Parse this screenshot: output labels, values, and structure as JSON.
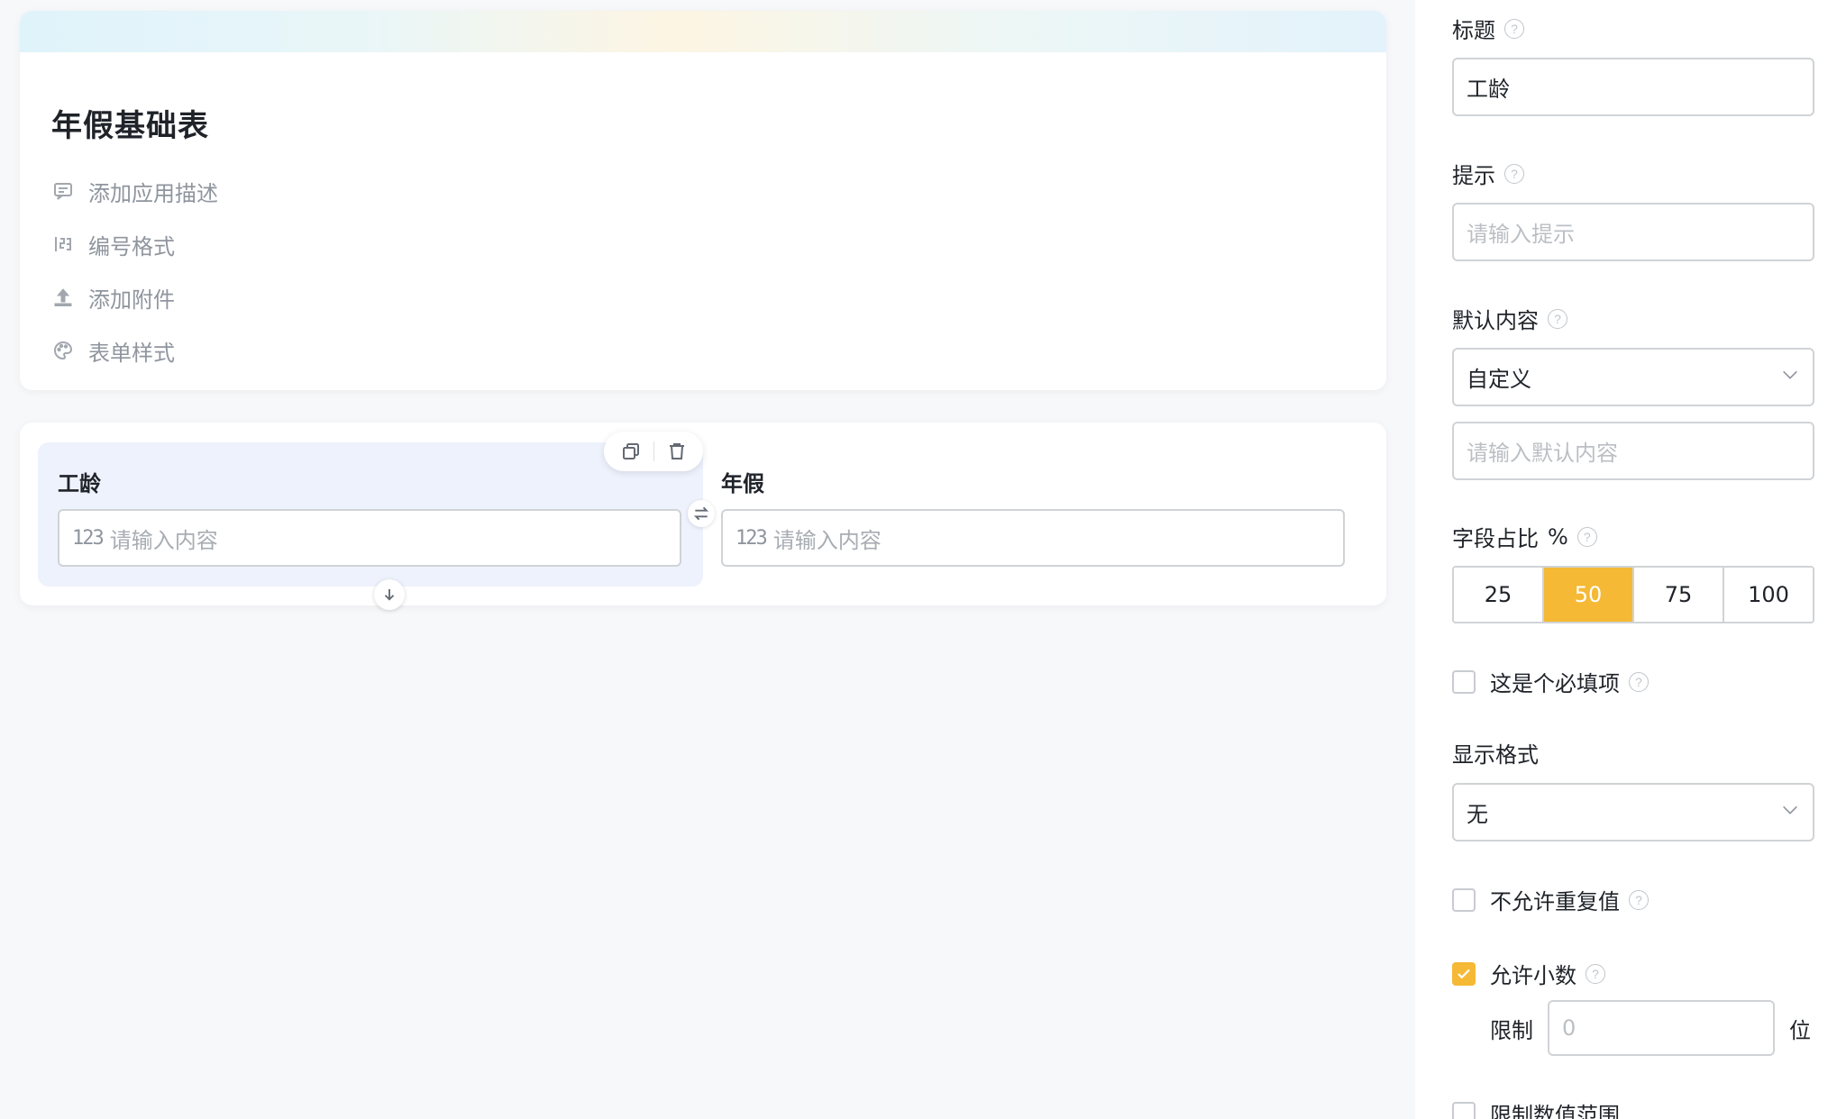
{
  "form": {
    "title": "年假基础表",
    "meta_items": [
      {
        "icon": "comment-icon",
        "label": "添加应用描述"
      },
      {
        "icon": "numbering-icon",
        "label": "编号格式"
      },
      {
        "icon": "upload-icon",
        "label": "添加附件"
      },
      {
        "icon": "palette-icon",
        "label": "表单样式"
      }
    ]
  },
  "fields": [
    {
      "label": "工龄",
      "icon": "123",
      "placeholder": "请输入内容",
      "selected": true
    },
    {
      "label": "年假",
      "icon": "123",
      "placeholder": "请输入内容",
      "selected": false
    }
  ],
  "panel": {
    "title": {
      "label": "标题",
      "value": "工龄"
    },
    "hint": {
      "label": "提示",
      "placeholder": "请输入提示"
    },
    "default": {
      "label": "默认内容",
      "mode": "自定义",
      "placeholder": "请输入默认内容"
    },
    "ratio": {
      "label": "字段占比",
      "unit": "%",
      "options": [
        "25",
        "50",
        "75",
        "100"
      ],
      "selected": "50"
    },
    "required": {
      "label": "这是个必填项",
      "checked": false
    },
    "display_format": {
      "label": "显示格式",
      "value": "无"
    },
    "no_duplicate": {
      "label": "不允许重复值",
      "checked": false
    },
    "allow_decimal": {
      "label": "允许小数",
      "checked": true,
      "limit_label": "限制",
      "limit_placeholder": "0",
      "limit_unit": "位"
    },
    "limit_range": {
      "label": "限制数值范围",
      "checked": false
    }
  },
  "colors": {
    "accent": "#f5b935",
    "selected_field_bg": "#eef2fd",
    "canvas_bg": "#f7f8fa"
  }
}
